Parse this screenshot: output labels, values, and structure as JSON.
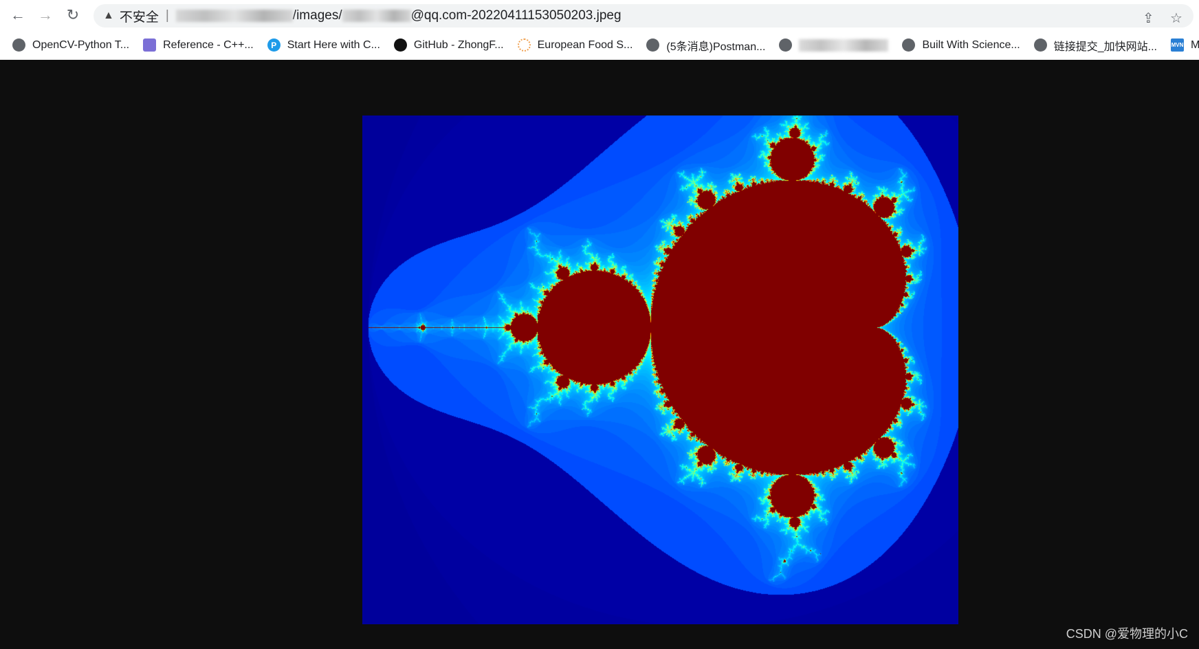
{
  "browser": {
    "security_label": "不安全",
    "url_visible_parts": [
      "/images/",
      "@qq.com-20220411153050203.jpeg"
    ],
    "icons": {
      "back": "arrow-left-icon",
      "forward": "arrow-right-icon",
      "reload": "reload-icon",
      "share": "share-icon",
      "star": "star-icon"
    }
  },
  "bookmarks": [
    {
      "label": "OpenCV-Python T...",
      "icon": "globe-icon"
    },
    {
      "label": "Reference - C++...",
      "icon": "cpp-reference-icon"
    },
    {
      "label": "Start Here with C...",
      "icon": "python-icon"
    },
    {
      "label": "GitHub - ZhongF...",
      "icon": "github-icon"
    },
    {
      "label": "European Food S...",
      "icon": "loading-icon"
    },
    {
      "label": "(5条消息)Postman...",
      "icon": "globe-icon"
    },
    {
      "label": "",
      "icon": "globe-icon"
    },
    {
      "label": "Built With Science...",
      "icon": "globe-icon"
    },
    {
      "label": "链接提交_加快网站...",
      "icon": "globe-icon"
    },
    {
      "label": "M",
      "icon": "mvn-icon"
    }
  ],
  "image": {
    "content": "Mandelbrot set",
    "colors": {
      "interior": "#800000",
      "background": "#0000a8"
    }
  },
  "watermark": "CSDN @爱物理的小C"
}
